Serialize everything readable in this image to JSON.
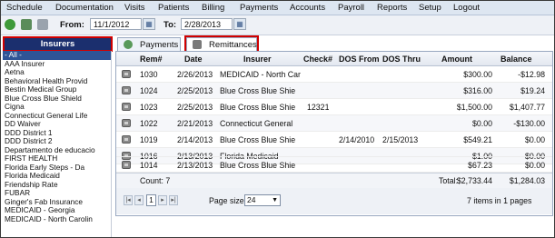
{
  "menu": [
    "Schedule",
    "Documentation",
    "Visits",
    "Patients",
    "Billing",
    "Payments",
    "Accounts",
    "Payroll",
    "Reports",
    "Setup",
    "Logout"
  ],
  "toolbar": {
    "from_label": "From:",
    "from_value": "11/1/2012",
    "to_label": "To:",
    "to_value": "2/28/2013"
  },
  "insurers": {
    "header": "Insurers",
    "items": [
      "- All -",
      "AAA Insurer",
      "Aetna",
      "Behavioral Health Provid",
      "Bestin Medical Group",
      "Blue Cross Blue Shield",
      "Cigna",
      "Connecticut General Life",
      "DD Waiver",
      "DDD District 1",
      "DDD District 2",
      "Departamento de educacio",
      "FIRST HEALTH",
      "Florida Early Steps - Da",
      "Florida Medicaid",
      "Friendship Rate",
      "FUBAR",
      "Ginger's Fab Insurance",
      "MEDICAID - Georgia",
      "MEDICAID - North Carolin"
    ],
    "selected_index": 0
  },
  "tabs": [
    "Payments",
    "Remittances"
  ],
  "grid": {
    "headers": {
      "rem": "Rem#",
      "date": "Date",
      "insurer": "Insurer",
      "check": "Check#",
      "dos_from": "DOS From",
      "dos_thru": "DOS Thru",
      "amount": "Amount",
      "balance": "Balance"
    },
    "rows": [
      {
        "rem": "1030",
        "date": "2/26/2013",
        "insurer": "MEDICAID - North Car",
        "check": "",
        "dos_from": "",
        "dos_thru": "",
        "amount": "$300.00",
        "balance": "-$12.98"
      },
      {
        "rem": "1024",
        "date": "2/25/2013",
        "insurer": "Blue Cross Blue Shie",
        "check": "",
        "dos_from": "",
        "dos_thru": "",
        "amount": "$316.00",
        "balance": "$19.24"
      },
      {
        "rem": "1023",
        "date": "2/25/2013",
        "insurer": "Blue Cross Blue Shie",
        "check": "12321",
        "dos_from": "",
        "dos_thru": "",
        "amount": "$1,500.00",
        "balance": "$1,407.77"
      },
      {
        "rem": "1022",
        "date": "2/21/2013",
        "insurer": "Connecticut General",
        "check": "",
        "dos_from": "",
        "dos_thru": "",
        "amount": "$0.00",
        "balance": "-$130.00"
      },
      {
        "rem": "1019",
        "date": "2/14/2013",
        "insurer": "Blue Cross Blue Shie",
        "check": "",
        "dos_from": "2/14/2010",
        "dos_thru": "2/15/2013",
        "amount": "$549.21",
        "balance": "$0.00"
      },
      {
        "rem": "1016",
        "date": "2/13/2013",
        "insurer": "Florida Medicaid",
        "check": "",
        "dos_from": "",
        "dos_thru": "",
        "amount": "$1.00",
        "balance": "$0.00"
      },
      {
        "rem": "1014",
        "date": "2/13/2013",
        "insurer": "Blue Cross Blue Shie",
        "check": "",
        "dos_from": "",
        "dos_thru": "",
        "amount": "$67.23",
        "balance": "$0.00"
      }
    ],
    "footer": {
      "count": "Count: 7",
      "total_label": "Total:",
      "total_amount": "$2,733.44",
      "total_balance": "$1,284.03"
    }
  },
  "pager": {
    "page": "1",
    "page_size_label": "Page size:",
    "page_size": "24",
    "summary": "7 items in 1 pages"
  },
  "colors": {
    "accent": "#1b2f6e",
    "highlight": "#d00000",
    "selected": "#2f5496"
  }
}
